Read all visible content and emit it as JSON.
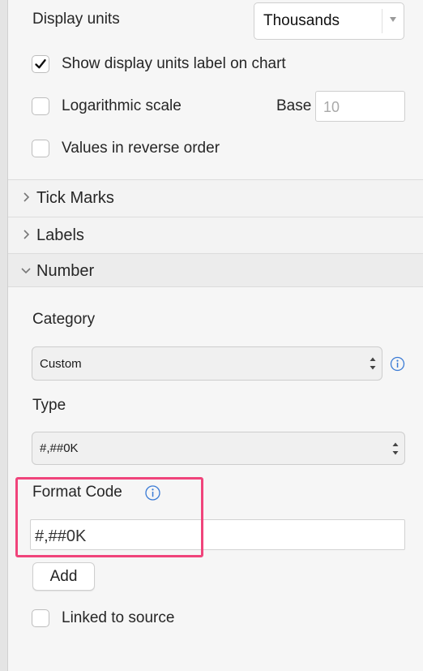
{
  "axis_options": {
    "display_units_label": "Display units",
    "display_units_value": "Thousands",
    "show_units_label": "Show display units label on chart",
    "show_units_checked": true,
    "log_scale_label": "Logarithmic scale",
    "log_scale_checked": false,
    "base_label": "Base",
    "base_placeholder": "10",
    "reverse_order_label": "Values in reverse order",
    "reverse_order_checked": false
  },
  "sections": {
    "tick_marks": "Tick Marks",
    "labels": "Labels",
    "number": "Number"
  },
  "number": {
    "category_label": "Category",
    "category_value": "Custom",
    "type_label": "Type",
    "type_value": "#,##0K",
    "format_code_label": "Format Code",
    "format_code_value": "#,##0K",
    "add_button": "Add",
    "linked_to_source_label": "Linked to source",
    "linked_to_source_checked": false
  },
  "colors": {
    "highlight": "#f0447b",
    "info_icon": "#3a7bd5",
    "checkmark": "#111111"
  },
  "icons": {
    "collapsed_section": "chevron-right-icon",
    "expanded_section": "chevron-down-icon",
    "info": "info-icon",
    "dropdown": "triangle-down-icon",
    "stepper": "updown-arrows-icon"
  }
}
